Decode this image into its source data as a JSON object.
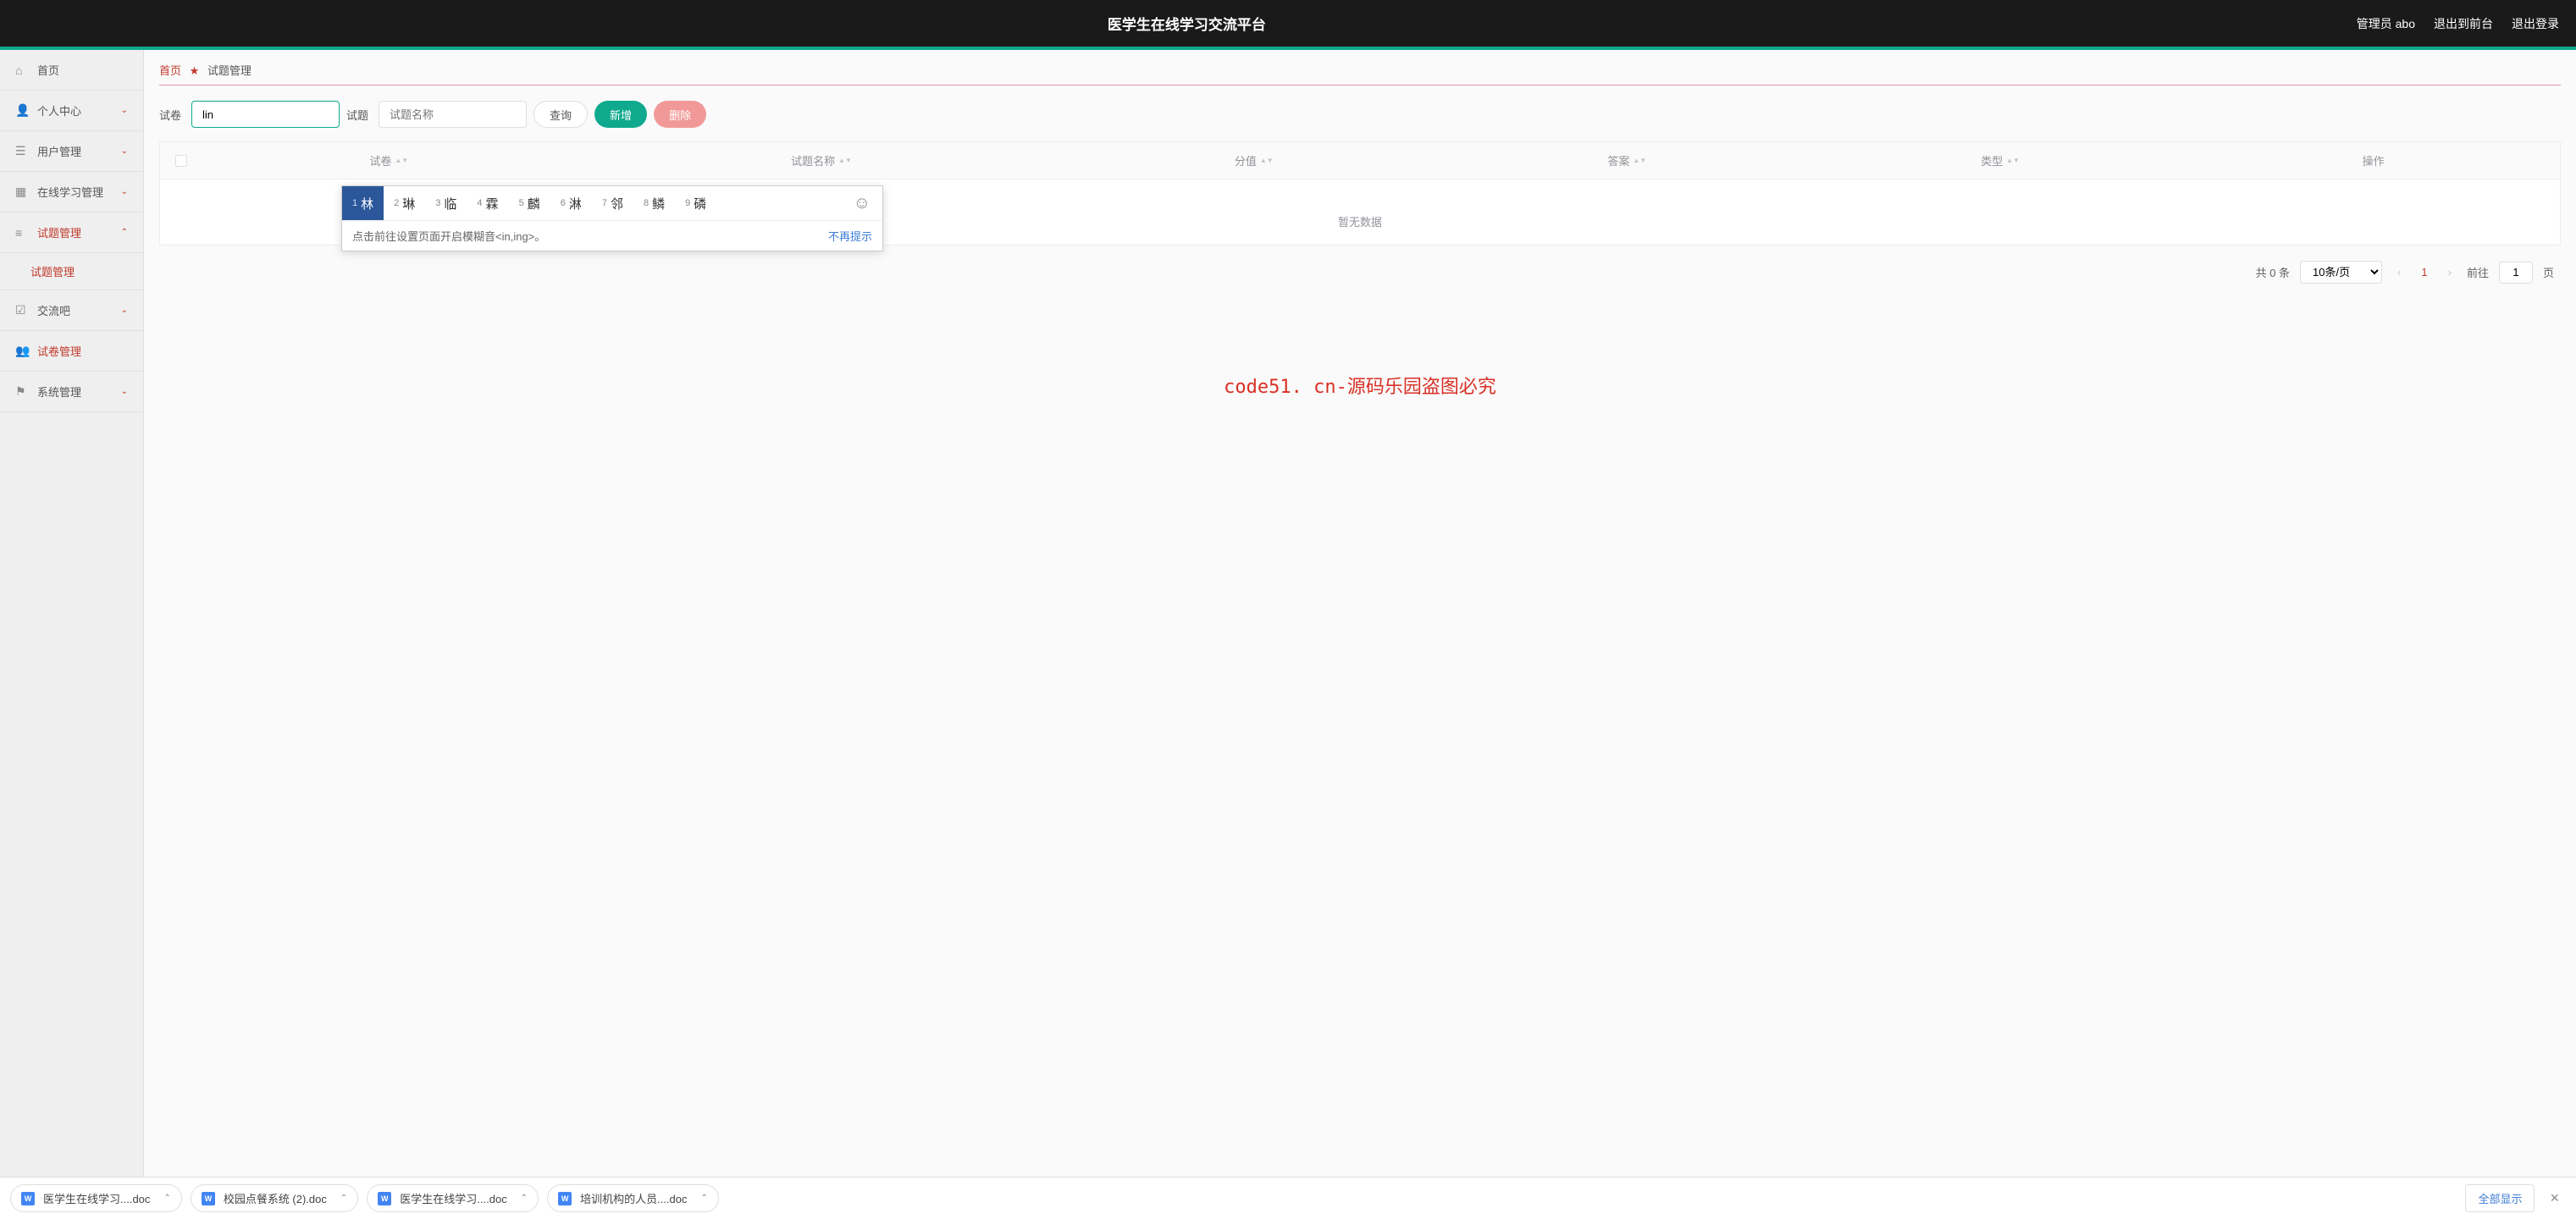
{
  "header": {
    "title": "医学生在线学习交流平台",
    "user": "管理员 abo",
    "exit_front": "退出到前台",
    "logout": "退出登录"
  },
  "sidebar": {
    "home": "首页",
    "items": [
      {
        "label": "个人中心",
        "icon": "user"
      },
      {
        "label": "用户管理",
        "icon": "list"
      },
      {
        "label": "在线学习管理",
        "icon": "grid"
      },
      {
        "label": "试题管理",
        "icon": "lines",
        "expanded": true,
        "red": true
      },
      {
        "label": "交流吧",
        "icon": "check"
      },
      {
        "label": "试卷管理",
        "icon": "person",
        "red": true
      },
      {
        "label": "系统管理",
        "icon": "flag"
      }
    ],
    "sub": "试题管理"
  },
  "breadcrumb": {
    "home": "首页",
    "current": "试题管理"
  },
  "filter": {
    "label1": "试卷",
    "input1_value": "lin",
    "label2": "试题",
    "input2_placeholder": "试题名称",
    "query": "查询",
    "add": "新增",
    "delete": "删除"
  },
  "table": {
    "columns": [
      "试卷",
      "试题名称",
      "分值",
      "答案",
      "类型",
      "操作"
    ],
    "empty": "暂无数据"
  },
  "pagination": {
    "total": "共 0 条",
    "page_size": "10条/页",
    "current": "1",
    "goto": "前往",
    "page_label": "页",
    "goto_value": "1"
  },
  "ime": {
    "candidates": [
      "林",
      "琳",
      "临",
      "霖",
      "麟",
      "淋",
      "邻",
      "鳞",
      "磷"
    ],
    "hint_text": "点击前往设置页面开启模糊音<in,ing>。",
    "dismiss": "不再提示"
  },
  "watermark": "code51. cn-源码乐园盗图必究",
  "downloads": {
    "items": [
      "医学生在线学习....doc",
      "校园点餐系统 (2).doc",
      "医学生在线学习....doc",
      "培训机构的人员....doc"
    ],
    "show_all": "全部显示"
  }
}
